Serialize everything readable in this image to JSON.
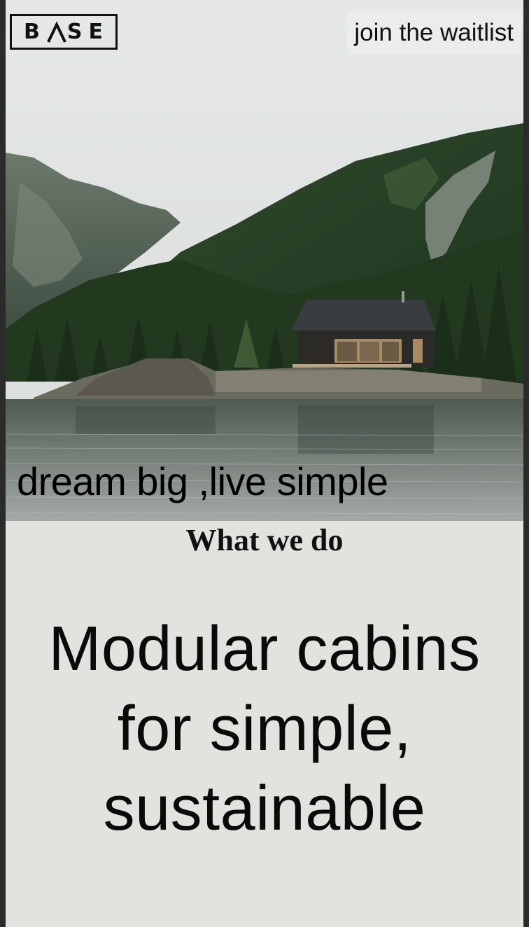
{
  "brand": {
    "logo_letters": [
      "B",
      "S",
      "E"
    ],
    "logo_text": "BASE"
  },
  "header": {
    "cta_label": "join the waitlist"
  },
  "hero": {
    "tagline": "dream big ,live simple",
    "image": "cabin-by-lake-with-forested-mountains"
  },
  "section": {
    "heading": "What we do",
    "headline": "Modular cabins for simple, sustainable"
  },
  "colors": {
    "frame_bg": "#e2e2df",
    "outer_bg": "#2b2b2b",
    "cta_bg": "#ececec",
    "text": "#111111"
  }
}
